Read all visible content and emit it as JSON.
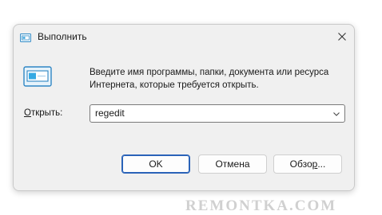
{
  "window": {
    "title": "Выполнить",
    "icon": "run-icon",
    "close_icon": "close-icon"
  },
  "content": {
    "icon": "run-icon",
    "description": "Введите имя программы, папки, документа или ресурса Интернета, которые требуется открыть.",
    "open_label_accel": "О",
    "open_label_rest": "ткрыть:",
    "open_value": "regedit"
  },
  "buttons": {
    "ok": "OK",
    "cancel": "Отмена",
    "browse_pre": "Обзо",
    "browse_accel": "р",
    "browse_post": "..."
  },
  "watermark": "REMONTKA.COM",
  "colors": {
    "accent": "#2a63b8",
    "dialog_bg": "#f0f0f0"
  }
}
